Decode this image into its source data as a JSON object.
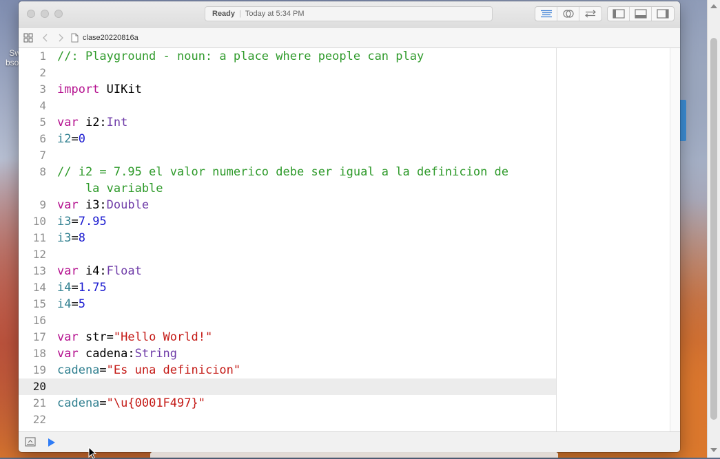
{
  "desktop": {
    "label_top": "Sw",
    "label_bottom": "bsol"
  },
  "window": {
    "activity": {
      "status": "Ready",
      "separator": "|",
      "time": "Today at 5:34 PM"
    },
    "jumpbar": {
      "file_name": "clase20220816a"
    }
  },
  "editor": {
    "current_line": 20,
    "lines": [
      {
        "n": "1",
        "tokens": [
          {
            "t": "//: Playground - noun: a place where people can play",
            "c": "comment"
          }
        ]
      },
      {
        "n": "2",
        "tokens": []
      },
      {
        "n": "3",
        "tokens": [
          {
            "t": "import",
            "c": "kw"
          },
          {
            "t": " UIKit",
            "c": "plain"
          }
        ]
      },
      {
        "n": "4",
        "tokens": []
      },
      {
        "n": "5",
        "tokens": [
          {
            "t": "var",
            "c": "kw"
          },
          {
            "t": " i2:",
            "c": "plain"
          },
          {
            "t": "Int",
            "c": "type"
          }
        ]
      },
      {
        "n": "6",
        "tokens": [
          {
            "t": "i2",
            "c": "var"
          },
          {
            "t": "=",
            "c": "plain"
          },
          {
            "t": "0",
            "c": "num"
          }
        ]
      },
      {
        "n": "7",
        "tokens": []
      },
      {
        "n": "8",
        "tokens": [
          {
            "t": "// i2 = 7.95 el valor numerico debe ser igual a la definicion de",
            "c": "comment"
          }
        ]
      },
      {
        "n": "",
        "tokens": [
          {
            "t": "    la variable",
            "c": "comment"
          }
        ]
      },
      {
        "n": "9",
        "tokens": [
          {
            "t": "var",
            "c": "kw"
          },
          {
            "t": " i3:",
            "c": "plain"
          },
          {
            "t": "Double",
            "c": "type"
          }
        ]
      },
      {
        "n": "10",
        "tokens": [
          {
            "t": "i3",
            "c": "var"
          },
          {
            "t": "=",
            "c": "plain"
          },
          {
            "t": "7.95",
            "c": "num"
          }
        ]
      },
      {
        "n": "11",
        "tokens": [
          {
            "t": "i3",
            "c": "var"
          },
          {
            "t": "=",
            "c": "plain"
          },
          {
            "t": "8",
            "c": "num"
          }
        ]
      },
      {
        "n": "12",
        "tokens": []
      },
      {
        "n": "13",
        "tokens": [
          {
            "t": "var",
            "c": "kw"
          },
          {
            "t": " i4:",
            "c": "plain"
          },
          {
            "t": "Float",
            "c": "type"
          }
        ]
      },
      {
        "n": "14",
        "tokens": [
          {
            "t": "i4",
            "c": "var"
          },
          {
            "t": "=",
            "c": "plain"
          },
          {
            "t": "1.75",
            "c": "num"
          }
        ]
      },
      {
        "n": "15",
        "tokens": [
          {
            "t": "i4",
            "c": "var"
          },
          {
            "t": "=",
            "c": "plain"
          },
          {
            "t": "5",
            "c": "num"
          }
        ]
      },
      {
        "n": "16",
        "tokens": []
      },
      {
        "n": "17",
        "tokens": [
          {
            "t": "var",
            "c": "kw"
          },
          {
            "t": " str=",
            "c": "plain"
          },
          {
            "t": "\"Hello World!\"",
            "c": "str"
          }
        ]
      },
      {
        "n": "18",
        "tokens": [
          {
            "t": "var",
            "c": "kw"
          },
          {
            "t": " cadena:",
            "c": "plain"
          },
          {
            "t": "String",
            "c": "type"
          }
        ]
      },
      {
        "n": "19",
        "tokens": [
          {
            "t": "cadena",
            "c": "var"
          },
          {
            "t": "=",
            "c": "plain"
          },
          {
            "t": "\"Es una definicion\"",
            "c": "str"
          }
        ]
      },
      {
        "n": "20",
        "tokens": []
      },
      {
        "n": "21",
        "tokens": [
          {
            "t": "cadena",
            "c": "var"
          },
          {
            "t": "=",
            "c": "plain"
          },
          {
            "t": "\"\\u{0001F497}\"",
            "c": "str"
          }
        ]
      },
      {
        "n": "22",
        "tokens": []
      }
    ]
  },
  "icons": {
    "traffic_lights": [
      "close-icon",
      "minimize-icon",
      "zoom-icon"
    ],
    "editor_buttons": [
      "standard-editor-icon",
      "assistant-editor-icon",
      "version-editor-icon"
    ],
    "view_buttons": [
      "navigator-toggle-icon",
      "debug-area-toggle-icon",
      "utilities-toggle-icon"
    ],
    "jumpbar": [
      "related-items-icon",
      "back-chevron-icon",
      "forward-chevron-icon",
      "swift-file-icon"
    ],
    "bottombar": [
      "show-debug-area-icon",
      "run-playground-icon"
    ]
  },
  "colors": {
    "comment": "#2e9a2a",
    "keyword": "#b40f8e",
    "type": "#6f3ca8",
    "variable": "#2f7f8f",
    "number": "#1b1bd0",
    "string": "#c41a16",
    "run_button": "#2f7cf6",
    "editor_button_active": "#3b7fd6"
  }
}
